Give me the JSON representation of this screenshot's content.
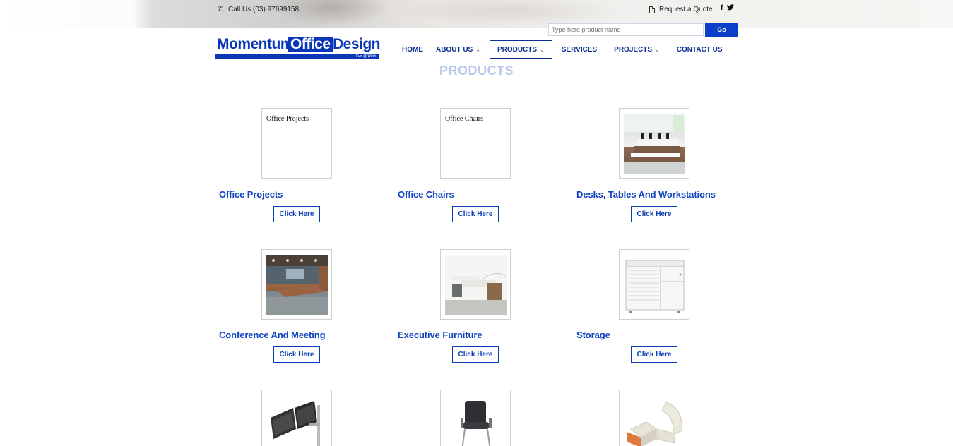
{
  "topbar": {
    "phone_label": "Call Us (03) 97699158",
    "quote_label": "Request a Quote",
    "social": [
      "f",
      "t"
    ]
  },
  "search": {
    "placeholder": "Type here product name",
    "button_label": "Go"
  },
  "logo": {
    "word1": "Momentum",
    "word2": "Office",
    "word3": "Design",
    "tagline": "Fun @ Work"
  },
  "nav": {
    "items": [
      {
        "label": "HOME",
        "dropdown": false
      },
      {
        "label": "ABOUT US",
        "dropdown": true
      },
      {
        "label": "PRODUCTS",
        "dropdown": true,
        "active": true
      },
      {
        "label": "SERVICES",
        "dropdown": false
      },
      {
        "label": "PROJECTS",
        "dropdown": true
      },
      {
        "label": "CONTACT US",
        "dropdown": false
      }
    ],
    "chevron": "⌄"
  },
  "page_title": "PRODUCTS",
  "products": [
    {
      "title": "Office Projects",
      "button": "Click Here",
      "image_alt": "Office Projects",
      "image": "broken"
    },
    {
      "title": "Office Chairs",
      "button": "Click Here",
      "image_alt": "Office Chairs",
      "image": "broken"
    },
    {
      "title": "Desks, Tables And Workstations",
      "button": "Click Here",
      "image": "desks-photo"
    },
    {
      "title": "Conference And Meeting",
      "button": "Click Here",
      "image": "conference-photo"
    },
    {
      "title": "Executive Furniture",
      "button": "Click Here",
      "image": "executive-photo"
    },
    {
      "title": "Storage",
      "button": "Click Here",
      "image": "storage-photo"
    },
    {
      "image": "monitor-arm-photo"
    },
    {
      "image": "chair-photo"
    },
    {
      "image": "lounge-photo"
    }
  ],
  "colors": {
    "brand_blue": "#0c3fc8",
    "title_blue": "#1243c2",
    "nav_blue": "#0b2f8f"
  }
}
